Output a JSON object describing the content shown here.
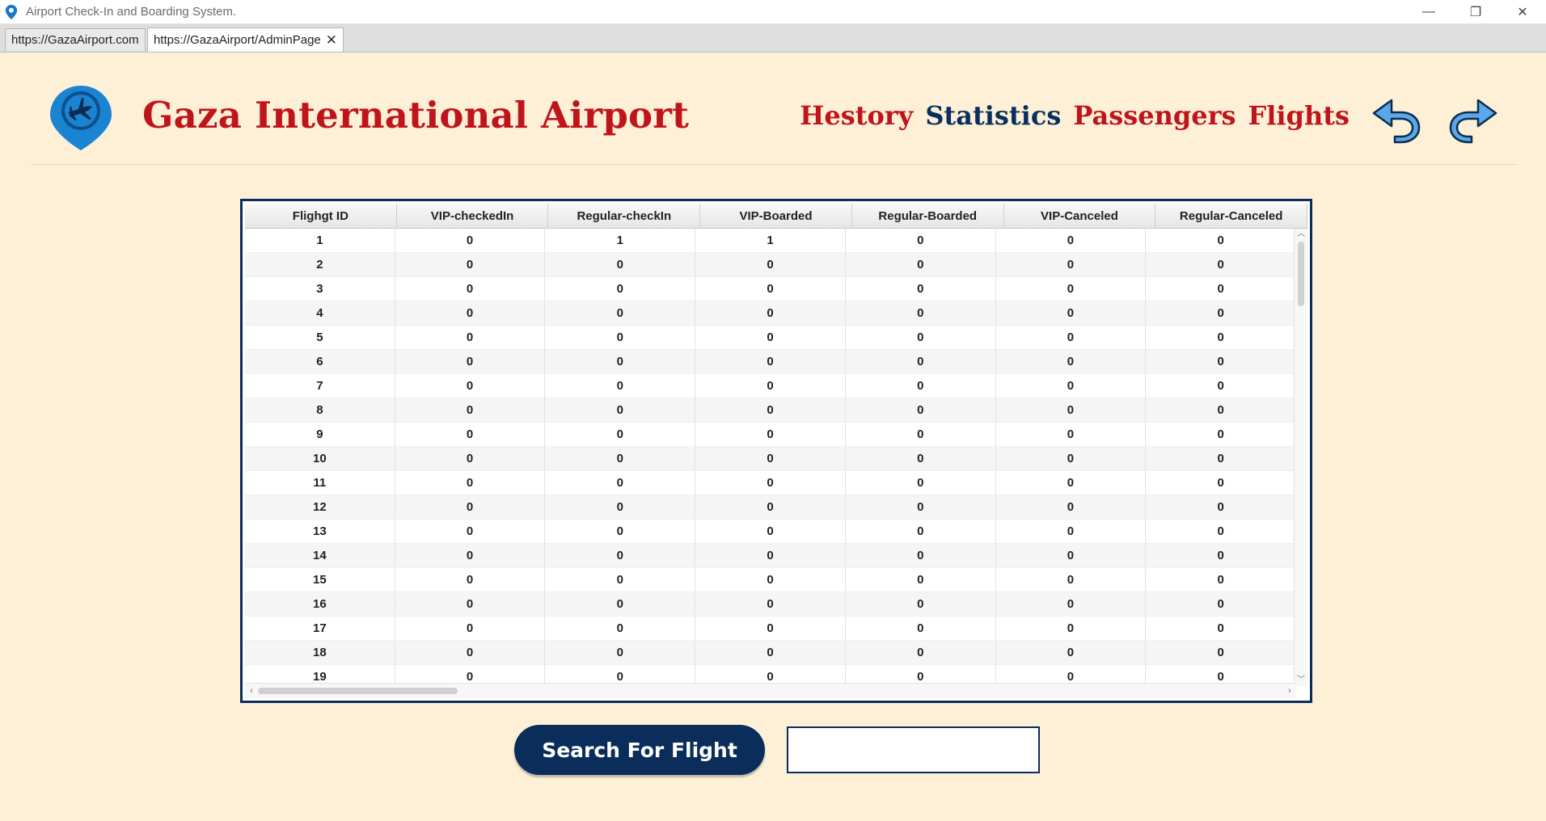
{
  "window": {
    "title": "Airport Check-In and Boarding System.",
    "app_icon": "location-pin-icon",
    "controls": {
      "minimize": "—",
      "restore": "❐",
      "close": "✕"
    }
  },
  "tabs": [
    {
      "label": "https://GazaAirport.com",
      "active": false
    },
    {
      "label": "https://GazaAirport/AdminPage",
      "active": true,
      "close": "✕"
    }
  ],
  "header": {
    "title": "Gaza International Airport",
    "logo_icon": "airplane-location-pin-icon",
    "nav": [
      "Hestory",
      "Statistics",
      "Passengers",
      "Flights"
    ],
    "active_nav": "Statistics",
    "undo_icon": "undo-arrow-icon",
    "redo_icon": "redo-arrow-icon"
  },
  "colors": {
    "background": "#fdf0d7",
    "title_red": "#c0141b",
    "navy": "#0b2d5b"
  },
  "table": {
    "columns": [
      "Flighgt ID",
      "VIP-checkedIn",
      "Regular-checkIn",
      "VIP-Boarded",
      "Regular-Boarded",
      "VIP-Canceled",
      "Regular-Canceled"
    ],
    "rows": [
      [
        "1",
        "0",
        "1",
        "1",
        "0",
        "0",
        "0"
      ],
      [
        "2",
        "0",
        "0",
        "0",
        "0",
        "0",
        "0"
      ],
      [
        "3",
        "0",
        "0",
        "0",
        "0",
        "0",
        "0"
      ],
      [
        "4",
        "0",
        "0",
        "0",
        "0",
        "0",
        "0"
      ],
      [
        "5",
        "0",
        "0",
        "0",
        "0",
        "0",
        "0"
      ],
      [
        "6",
        "0",
        "0",
        "0",
        "0",
        "0",
        "0"
      ],
      [
        "7",
        "0",
        "0",
        "0",
        "0",
        "0",
        "0"
      ],
      [
        "8",
        "0",
        "0",
        "0",
        "0",
        "0",
        "0"
      ],
      [
        "9",
        "0",
        "0",
        "0",
        "0",
        "0",
        "0"
      ],
      [
        "10",
        "0",
        "0",
        "0",
        "0",
        "0",
        "0"
      ],
      [
        "11",
        "0",
        "0",
        "0",
        "0",
        "0",
        "0"
      ],
      [
        "12",
        "0",
        "0",
        "0",
        "0",
        "0",
        "0"
      ],
      [
        "13",
        "0",
        "0",
        "0",
        "0",
        "0",
        "0"
      ],
      [
        "14",
        "0",
        "0",
        "0",
        "0",
        "0",
        "0"
      ],
      [
        "15",
        "0",
        "0",
        "0",
        "0",
        "0",
        "0"
      ],
      [
        "16",
        "0",
        "0",
        "0",
        "0",
        "0",
        "0"
      ],
      [
        "17",
        "0",
        "0",
        "0",
        "0",
        "0",
        "0"
      ],
      [
        "18",
        "0",
        "0",
        "0",
        "0",
        "0",
        "0"
      ],
      [
        "19",
        "0",
        "0",
        "0",
        "0",
        "0",
        "0"
      ]
    ]
  },
  "search": {
    "button_label": "Search For Flight",
    "input_value": ""
  }
}
